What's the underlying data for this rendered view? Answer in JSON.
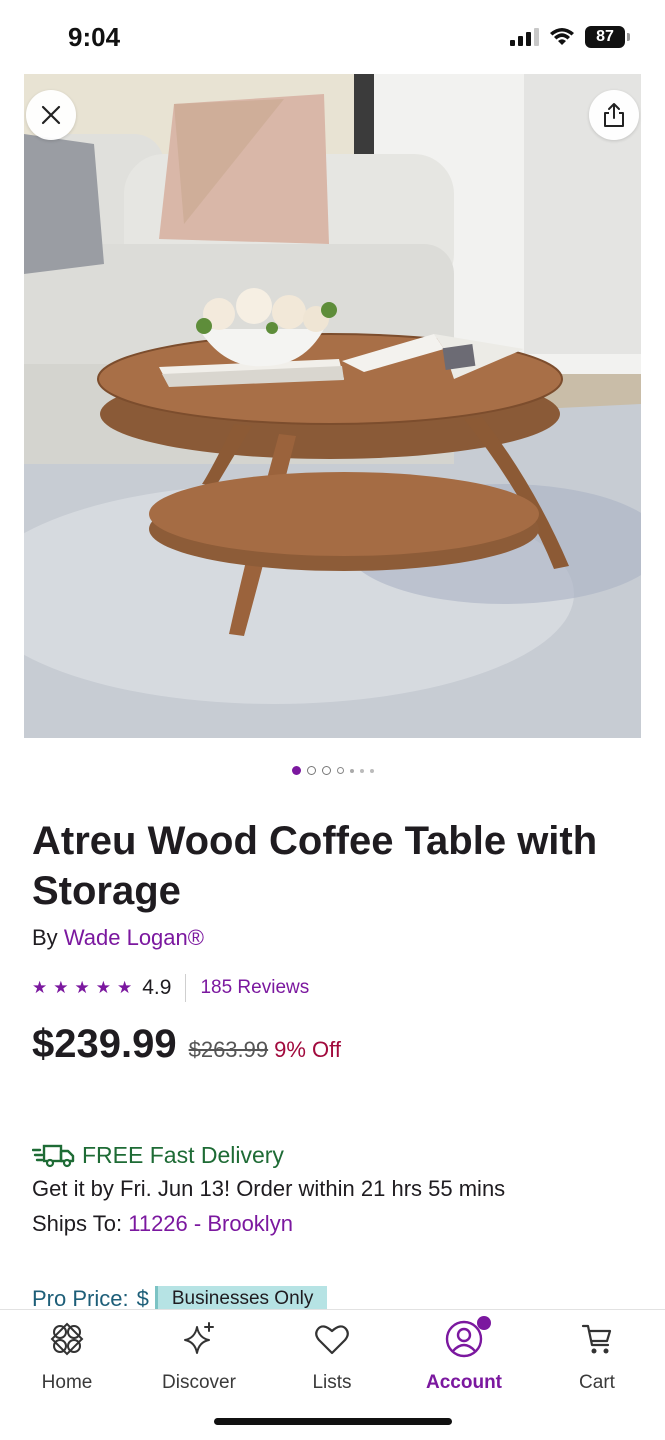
{
  "status_bar": {
    "time": "9:04",
    "battery": "87"
  },
  "colors": {
    "brand_purple": "#7b189f",
    "delivery_green": "#1e6b35",
    "discount_red": "#a10a3d",
    "pro_teal": "#1d5e78"
  },
  "hero": {
    "close_icon": "close-icon",
    "share_icon": "share-icon",
    "image_count": 7,
    "active_index": 0
  },
  "product": {
    "title": "Atreu Wood Coffee Table with Storage",
    "by_prefix": "By",
    "brand": "Wade Logan®",
    "rating": "4.9",
    "stars": 5,
    "reviews": "185 Reviews",
    "price": "$239.99",
    "old_price": "$263.99",
    "discount": "9% Off"
  },
  "delivery": {
    "title": "FREE Fast Delivery",
    "eta": "Get it by Fri. Jun 13! Order within 21 hrs 55 mins",
    "ships_label": "Ships To:",
    "ships_location": "11226 - Brooklyn"
  },
  "pro": {
    "label": "Pro Price:",
    "currency": "$",
    "badge": "Businesses Only"
  },
  "tabbar": {
    "items": [
      {
        "label": "Home",
        "icon": "home-icon"
      },
      {
        "label": "Discover",
        "icon": "sparkle-icon"
      },
      {
        "label": "Lists",
        "icon": "heart-icon"
      },
      {
        "label": "Account",
        "icon": "account-icon",
        "active": true
      },
      {
        "label": "Cart",
        "icon": "cart-icon"
      }
    ]
  }
}
